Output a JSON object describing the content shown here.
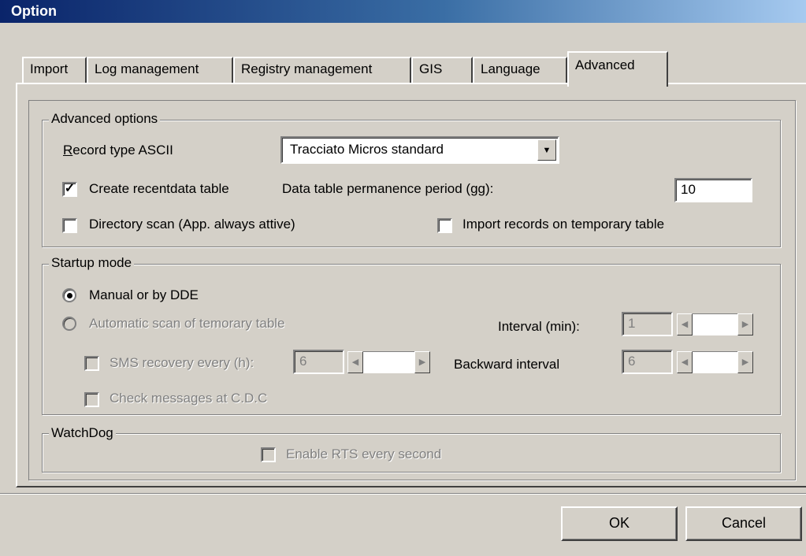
{
  "window": {
    "title": "Option"
  },
  "tabs": [
    {
      "label": "Import"
    },
    {
      "label": "Log management"
    },
    {
      "label": "Registry management"
    },
    {
      "label": "GIS"
    },
    {
      "label": "Language"
    },
    {
      "label": "Advanced",
      "active": true
    }
  ],
  "advanced_options": {
    "legend": "Advanced options",
    "record_type_label_first": "R",
    "record_type_label_rest": "ecord type ASCII",
    "record_type_value": "Tracciato Micros standard",
    "create_recentdata_label": "Create recentdata table",
    "create_recentdata_checked": true,
    "permanence_label": "Data table permanence period (gg):",
    "permanence_value": "10",
    "directory_scan_label": "Directory scan (App. always attive)",
    "directory_scan_checked": false,
    "import_temp_label": "Import records on temporary table",
    "import_temp_checked": false
  },
  "startup_mode": {
    "legend": "Startup mode",
    "manual_label": "Manual or by DDE",
    "manual_selected": true,
    "automatic_label": "Automatic scan of temorary table",
    "interval_label": "Interval (min):",
    "interval_value": "1",
    "sms_label": "SMS recovery every (h):",
    "sms_value": "6",
    "backward_label": "Backward interval",
    "backward_value": "6",
    "check_messages_label": "Check messages at C.D.C"
  },
  "watchdog": {
    "legend": "WatchDog",
    "rts_label": "Enable RTS every second"
  },
  "buttons": {
    "ok": "OK",
    "cancel": "Cancel"
  },
  "icons": {
    "checkmark": "check-glyph",
    "dropdown": "down-triangle",
    "spin_left": "left-triangle",
    "spin_right": "right-triangle"
  }
}
